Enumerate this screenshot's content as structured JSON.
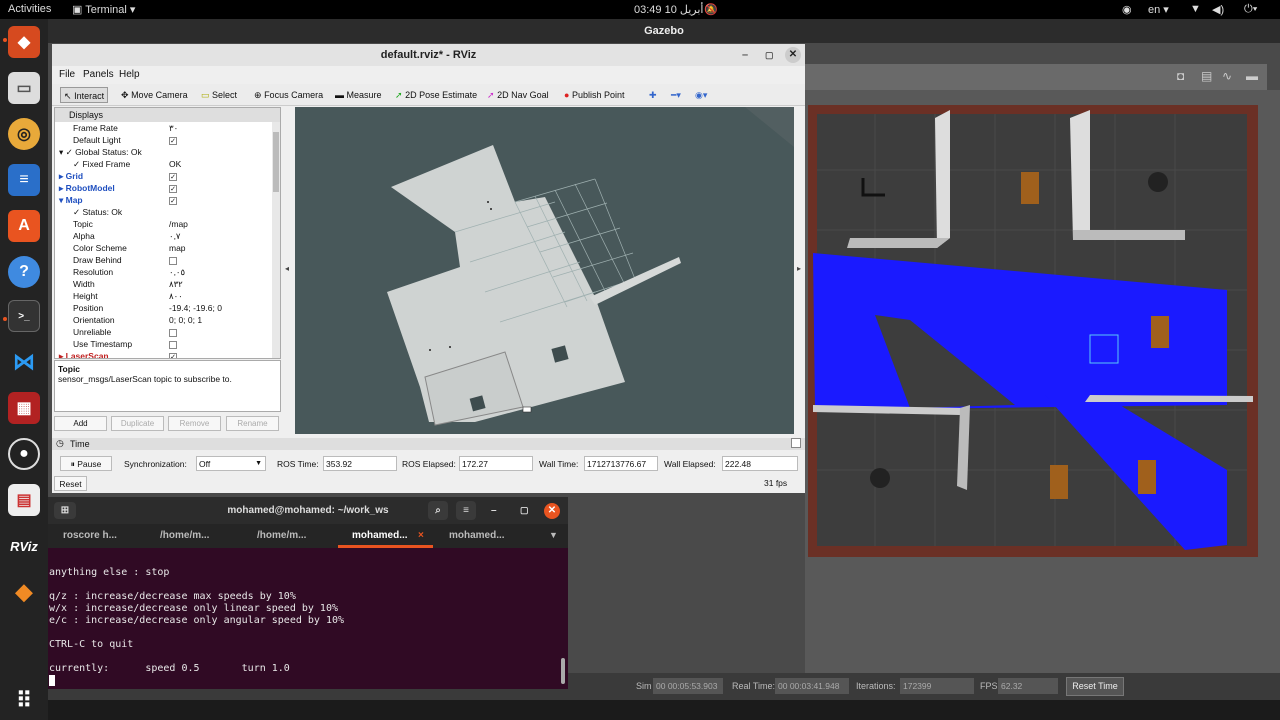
{
  "topbar": {
    "activities": "Activities",
    "app_menu": "Terminal",
    "clock": "03:49  10 أبريل",
    "lang": "en"
  },
  "gazebo": {
    "title": "Gazebo",
    "footer": {
      "sim_time_label": "Sim Time:",
      "sim_time_value": "00 00:05:53.903",
      "real_time_label": "Real Time:",
      "real_time_value": "00 00:03:41.948",
      "iterations_label": "Iterations:",
      "iterations_value": "172399",
      "fps_label": "FPS:",
      "fps_value": "62.32",
      "reset_time": "Reset Time"
    }
  },
  "rviz": {
    "title": "default.rviz* - RViz",
    "menu": [
      "File",
      "Panels",
      "Help"
    ],
    "tools": [
      "Interact",
      "Move Camera",
      "Select",
      "Focus Camera",
      "Measure",
      "2D Pose Estimate",
      "2D Nav Goal",
      "Publish Point"
    ],
    "displays_header": "Displays",
    "display_rows": [
      {
        "key": "Frame Rate",
        "value": "٣٠",
        "indent": 2
      },
      {
        "key": "Default Light",
        "check": true,
        "indent": 2
      },
      {
        "key": "Global Status: Ok",
        "indent": 1,
        "ok": true
      },
      {
        "key": "Fixed Frame",
        "value": "OK",
        "indent": 2,
        "ok": true
      },
      {
        "key": "Grid",
        "check": true,
        "indent": 1,
        "blue": true
      },
      {
        "key": "RobotModel",
        "check": true,
        "indent": 1,
        "blue": true
      },
      {
        "key": "Map",
        "check": true,
        "indent": 1,
        "blue": true
      },
      {
        "key": "Status: Ok",
        "indent": 2,
        "ok": true
      },
      {
        "key": "Topic",
        "value": "/map",
        "indent": 2
      },
      {
        "key": "Alpha",
        "value": "٠,٧",
        "indent": 2
      },
      {
        "key": "Color Scheme",
        "value": "map",
        "indent": 2
      },
      {
        "key": "Draw Behind",
        "check": false,
        "indent": 2
      },
      {
        "key": "Resolution",
        "value": "٠,٠٥",
        "indent": 2
      },
      {
        "key": "Width",
        "value": "٨٣٢",
        "indent": 2
      },
      {
        "key": "Height",
        "value": "٨٠٠",
        "indent": 2
      },
      {
        "key": "Position",
        "value": "-19.4; -19.6; 0",
        "indent": 2
      },
      {
        "key": "Orientation",
        "value": "0; 0; 0; 1",
        "indent": 2
      },
      {
        "key": "Unreliable",
        "check": false,
        "indent": 2
      },
      {
        "key": "Use Timestamp",
        "check": false,
        "indent": 2
      },
      {
        "key": "LaserScan",
        "check": true,
        "indent": 1,
        "red": true
      }
    ],
    "help_title": "Topic",
    "help_text": "sensor_msgs/LaserScan topic to subscribe to.",
    "panel_buttons": [
      "Add",
      "Duplicate",
      "Remove",
      "Rename"
    ],
    "time": {
      "header": "Time",
      "pause": "Pause",
      "sync_label": "Synchronization:",
      "sync_value": "Off",
      "ros_time_label": "ROS Time:",
      "ros_time_value": "353.92",
      "ros_elapsed_label": "ROS Elapsed:",
      "ros_elapsed_value": "172.27",
      "wall_time_label": "Wall Time:",
      "wall_time_value": "1712713776.67",
      "wall_elapsed_label": "Wall Elapsed:",
      "wall_elapsed_value": "222.48",
      "reset": "Reset",
      "fps": "31 fps"
    }
  },
  "terminal": {
    "title": "mohamed@mohamed: ~/work_ws",
    "tabs": [
      "roscore h...",
      "/home/m...",
      "/home/m...",
      "mohamed...",
      "mohamed..."
    ],
    "lines": [
      "anything else : stop",
      "",
      "q/z : increase/decrease max speeds by 10%",
      "w/x : increase/decrease only linear speed by 10%",
      "e/c : increase/decrease only angular speed by 10%",
      "",
      "CTRL-C to quit",
      "",
      "currently:      speed 0.5       turn 1.0"
    ]
  },
  "colors": {
    "laser": "#1a1aff",
    "map_free": "#cfd3d2",
    "viewport_bg": "#48585a",
    "terminal_bg": "#300a24",
    "ubuntu_orange": "#e95420"
  }
}
